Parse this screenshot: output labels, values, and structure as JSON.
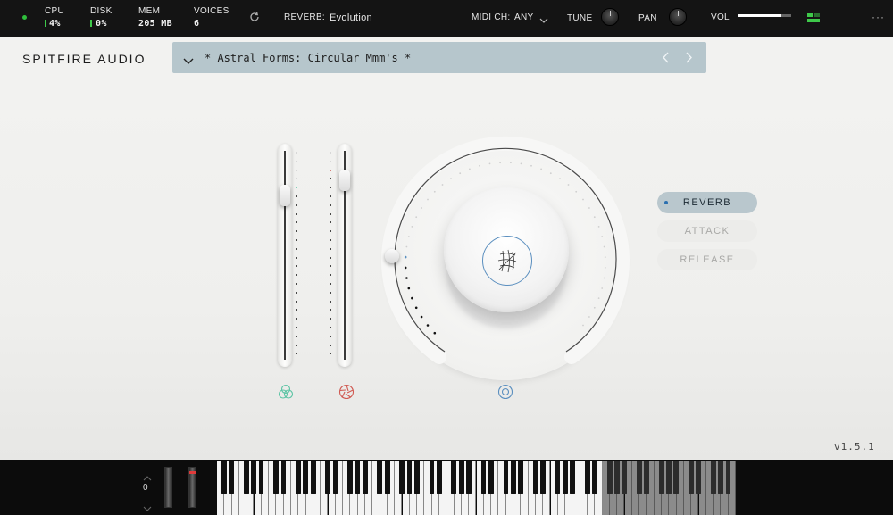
{
  "topbar": {
    "cpu_label": "CPU",
    "cpu_value": "4%",
    "disk_label": "DISK",
    "disk_value": "0%",
    "mem_label": "MEM",
    "mem_value": "205 MB",
    "voices_label": "VOICES",
    "voices_value": "6",
    "reset_icon": "refresh-icon",
    "reverb_label": "REVERB:",
    "reverb_value": "Evolution",
    "midi_label": "MIDI CH:",
    "midi_value": "ANY",
    "tune_label": "TUNE",
    "pan_label": "PAN",
    "vol_label": "VOL",
    "vol_level": 0.82,
    "more_icon": "ellipsis-icon",
    "accent_green": "#3ec94a"
  },
  "brand": "SPITFIRE AUDIO",
  "preset": {
    "name": "* Astral Forms: Circular Mmm's *",
    "prev_icon": "chevron-left-icon",
    "next_icon": "chevron-right-icon",
    "menu_icon": "chevron-down-icon"
  },
  "sliders": [
    {
      "name": "expression",
      "level": 0.82,
      "icon": "triple-circle-icon",
      "color": "#5cc4a4"
    },
    {
      "name": "dynamics",
      "level": 0.9,
      "icon": "aperture-icon",
      "color": "#d05a52"
    }
  ],
  "dial": {
    "icon": "astral-logo-icon",
    "mode_icon": "target-icon",
    "accent": "#5b8fbf"
  },
  "buttons": [
    {
      "label": "REVERB",
      "active": true
    },
    {
      "label": "ATTACK",
      "active": false
    },
    {
      "label": "RELEASE",
      "active": false
    }
  ],
  "version": "v1.5.1",
  "keyboard": {
    "octave": "0"
  }
}
